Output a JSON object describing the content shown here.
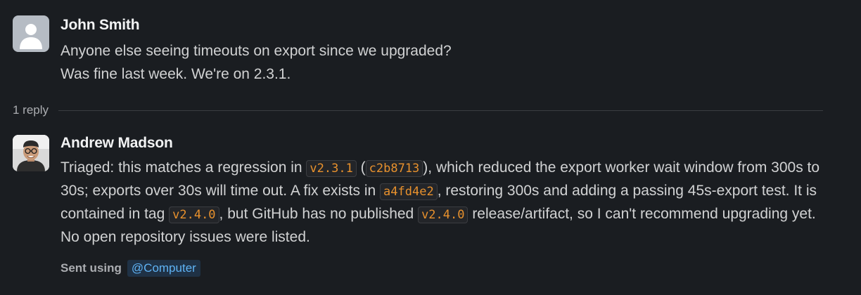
{
  "messages": [
    {
      "author": "John Smith",
      "lines": [
        "Anyone else seeing timeouts on export since we upgraded?",
        "Was fine last week. We're on 2.3.1."
      ]
    }
  ],
  "thread": {
    "reply_count_label": "1 reply"
  },
  "reply": {
    "author": "Andrew Madson",
    "segments": {
      "s1": "Triaged: this matches a regression in ",
      "c1": "v2.3.1",
      "s2": " (",
      "c2": "c2b8713",
      "s3": "), which reduced the export worker wait window from 300s to 30s; exports over 30s will time out. A fix exists in ",
      "c3": "a4fd4e2",
      "s4": ", restoring 300s and adding a passing 45s-export test. It is contained in tag ",
      "c4": "v2.4.0",
      "s5": ", but GitHub has no published ",
      "c5": "v2.4.0",
      "s6": " release/artifact, so I can't recommend upgrading yet. No open repository issues were listed."
    },
    "footer": {
      "sent_using": "Sent using",
      "mention": "@Computer"
    }
  }
}
